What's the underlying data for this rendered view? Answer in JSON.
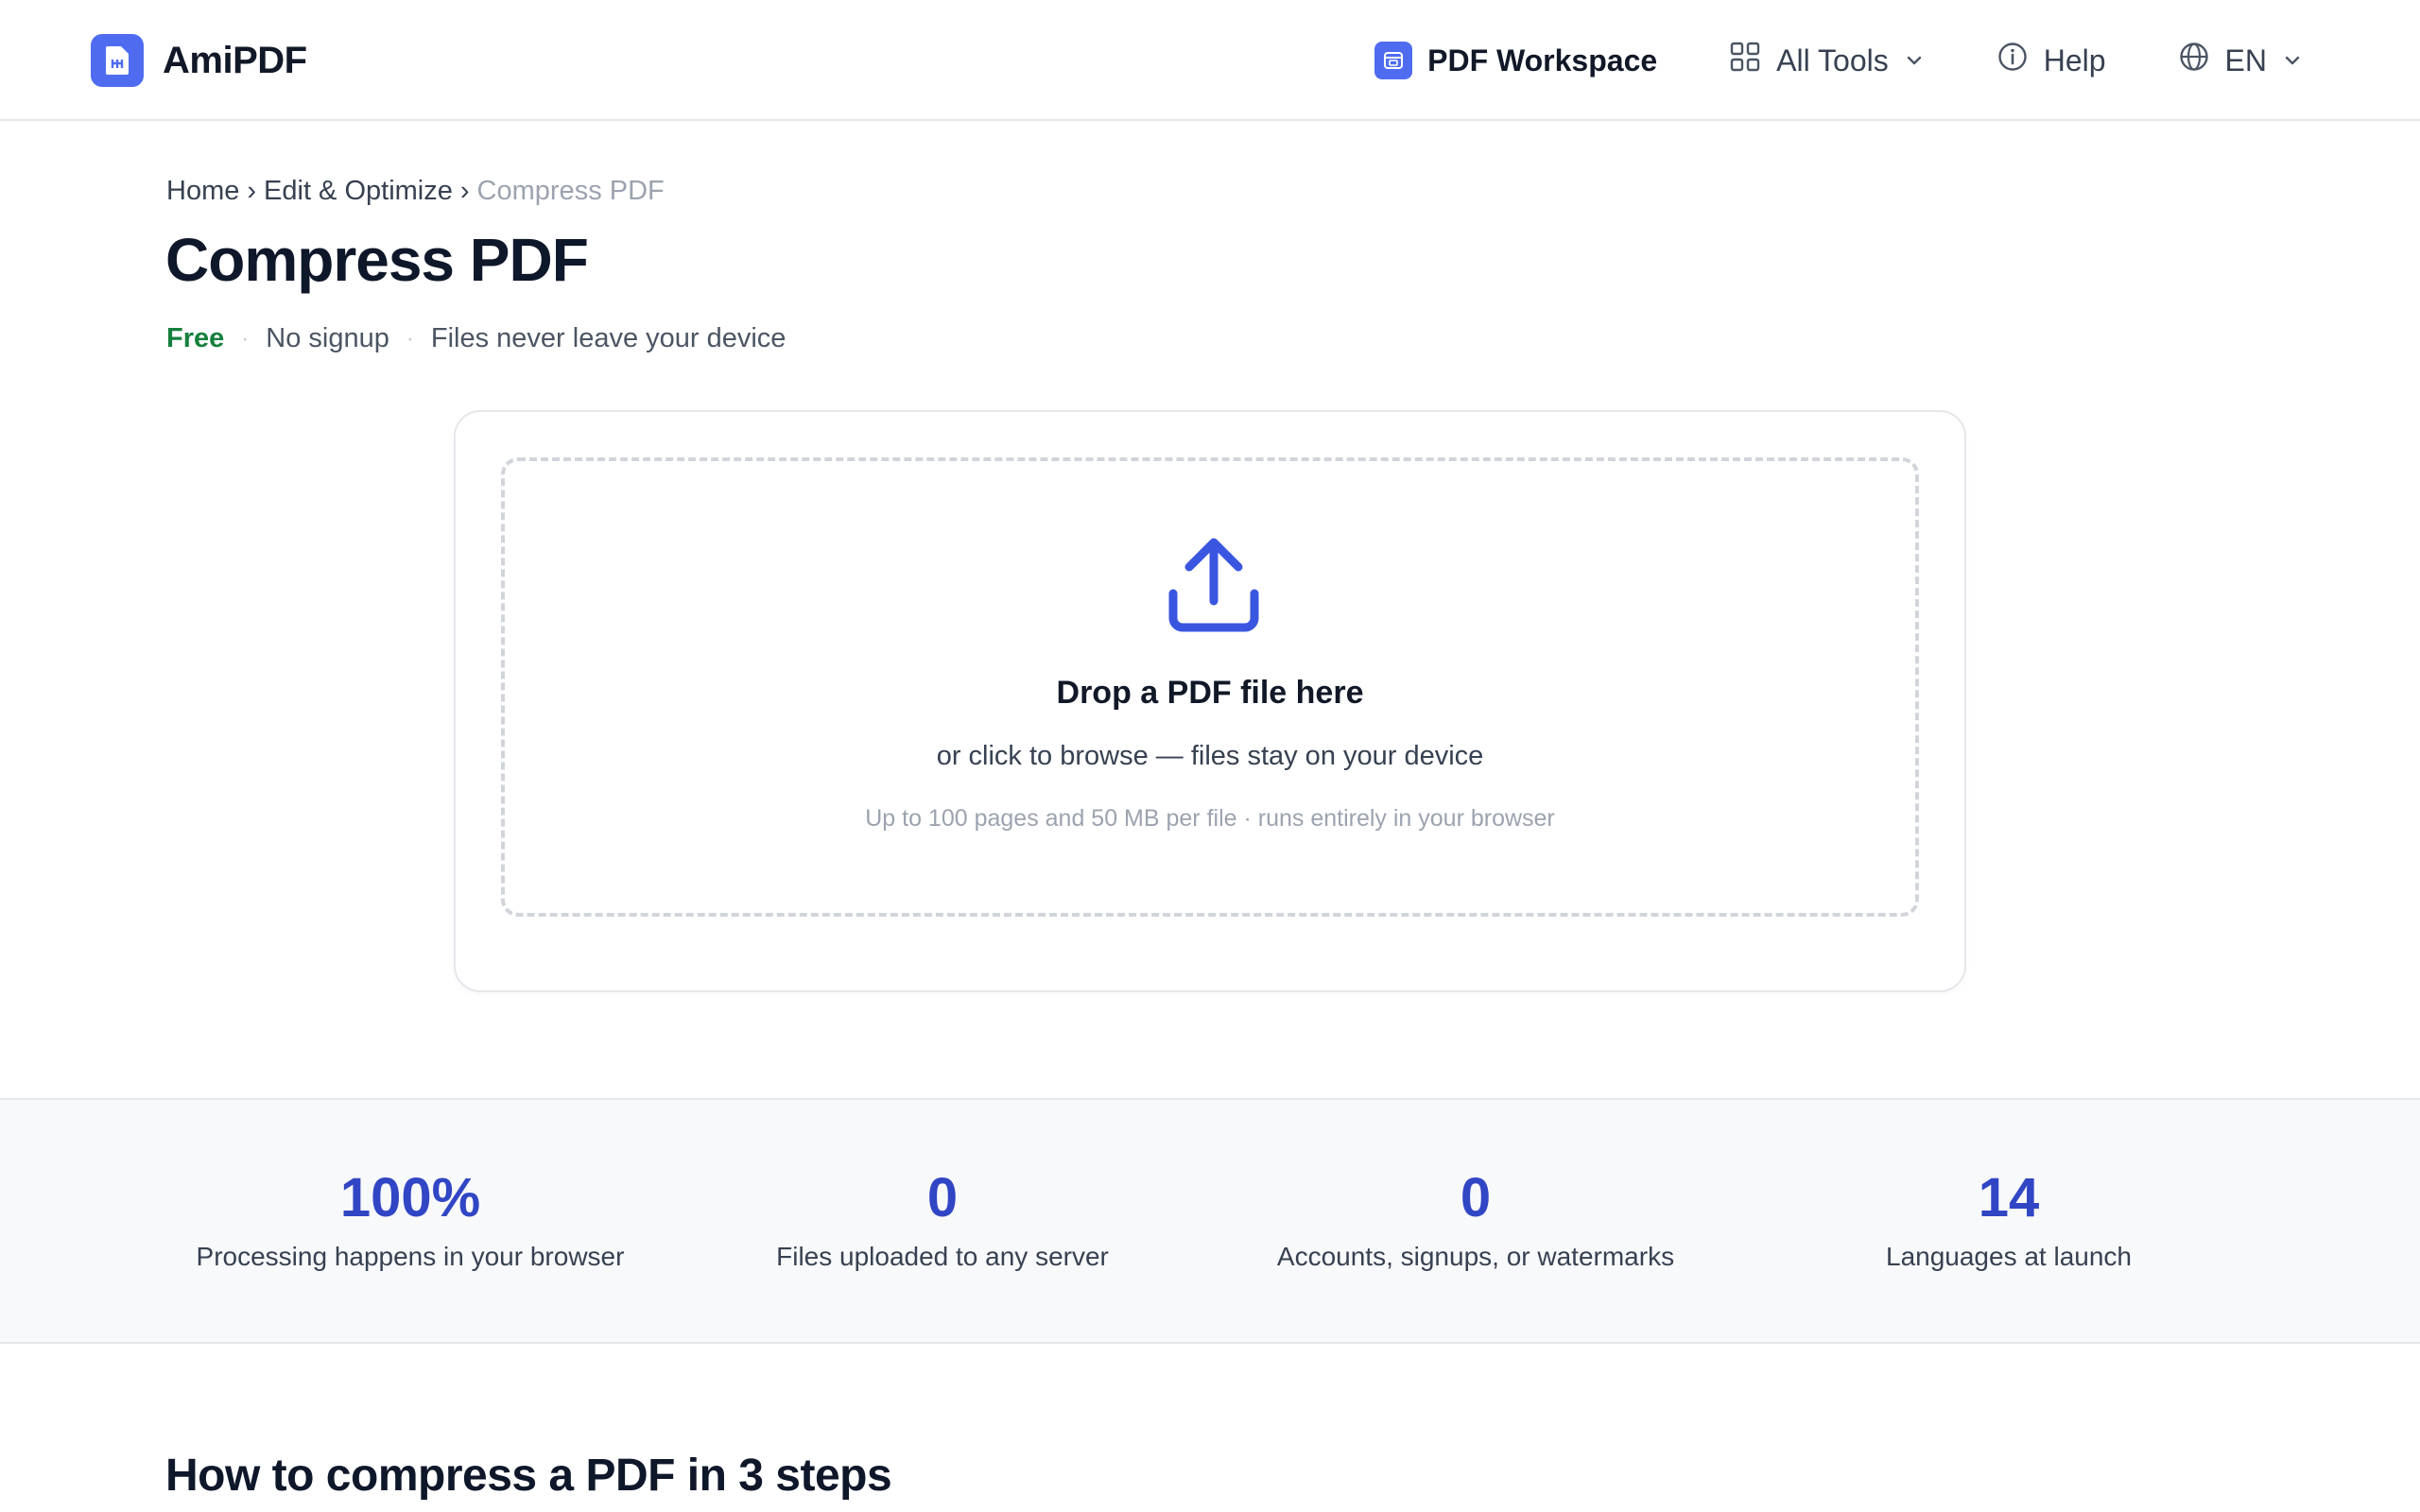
{
  "header": {
    "brand": "AmiPDF",
    "nav": {
      "workspace_label": "PDF Workspace",
      "tools_label": "All Tools",
      "help_label": "Help",
      "language_label": "EN"
    }
  },
  "breadcrumb": {
    "home": "Home",
    "sep1": "›",
    "section": "Edit & Optimize",
    "sep2": "›",
    "current": "Compress PDF"
  },
  "page": {
    "title": "Compress PDF",
    "tag_free": "Free",
    "tag_sep": "·",
    "tag_signup": "No signup",
    "tag_privacy": "Files never leave your device"
  },
  "upload": {
    "title": "Drop a PDF file here",
    "subtitle": "or click to browse — files stay on your device",
    "note": "Up to 100 pages and 50 MB per file · runs entirely in your browser"
  },
  "stats": [
    {
      "value": "100%",
      "label": "Processing happens in your browser"
    },
    {
      "value": "0",
      "label": "Files uploaded to any server"
    },
    {
      "value": "0",
      "label": "Accounts, signups, or watermarks"
    },
    {
      "value": "14",
      "label": "Languages at launch"
    }
  ],
  "howto": {
    "title": "How to compress a PDF in 3 steps"
  },
  "colors": {
    "accent": "#4f6cf0",
    "stat_value": "#3146c4",
    "free_green": "#15803d"
  }
}
